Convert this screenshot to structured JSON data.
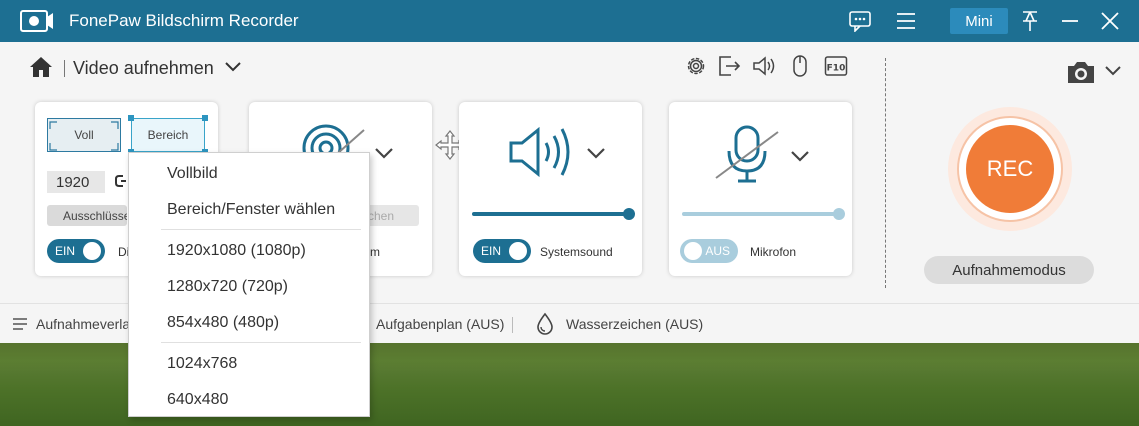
{
  "titlebar": {
    "app_title": "FonePaw Bildschirm Recorder",
    "mini_label": "Mini",
    "icons": [
      "app-logo-icon",
      "chat-icon",
      "menu-icon",
      "pin-icon",
      "minimize-icon",
      "close-icon"
    ]
  },
  "toolbar": {
    "mode_title": "Video aufnehmen",
    "icons": [
      "home-icon",
      "chevron-down-icon",
      "gear-icon",
      "export-icon",
      "speaker-icon",
      "mouse-icon",
      "hotkey-icon",
      "camera-icon"
    ],
    "hotkey_label": "F10"
  },
  "display_card": {
    "voll_label": "Voll",
    "bereich_label": "Bereich",
    "width_value": "1920",
    "exclude_label": "Ausschlüsse",
    "toggle_label": "EIN",
    "toggle_side_label": "Di"
  },
  "webcam_card": {
    "button_fragment": "chen",
    "label_fragment": "m"
  },
  "sound_card": {
    "toggle_label": "EIN",
    "label": "Systemsound",
    "volume": 1.0
  },
  "mic_card": {
    "toggle_label": "AUS",
    "label": "Mikrofon",
    "volume": 1.0
  },
  "rec": {
    "label": "REC",
    "mode_label": "Aufnahmemodus"
  },
  "bottombar": {
    "history_label": "Aufnahmeverlauf",
    "schedule_label": "Aufgabenplan (AUS)",
    "watermark_label": "Wasserzeichen (AUS)"
  },
  "dropdown": {
    "items": [
      "Vollbild",
      "Bereich/Fenster wählen",
      "1920x1080 (1080p)",
      "1280x720 (720p)",
      "854x480 (480p)",
      "1024x768",
      "640x480"
    ]
  },
  "colors": {
    "accent": "#1d6f92",
    "rec": "#f07c38",
    "mini": "#2c8bbb"
  }
}
